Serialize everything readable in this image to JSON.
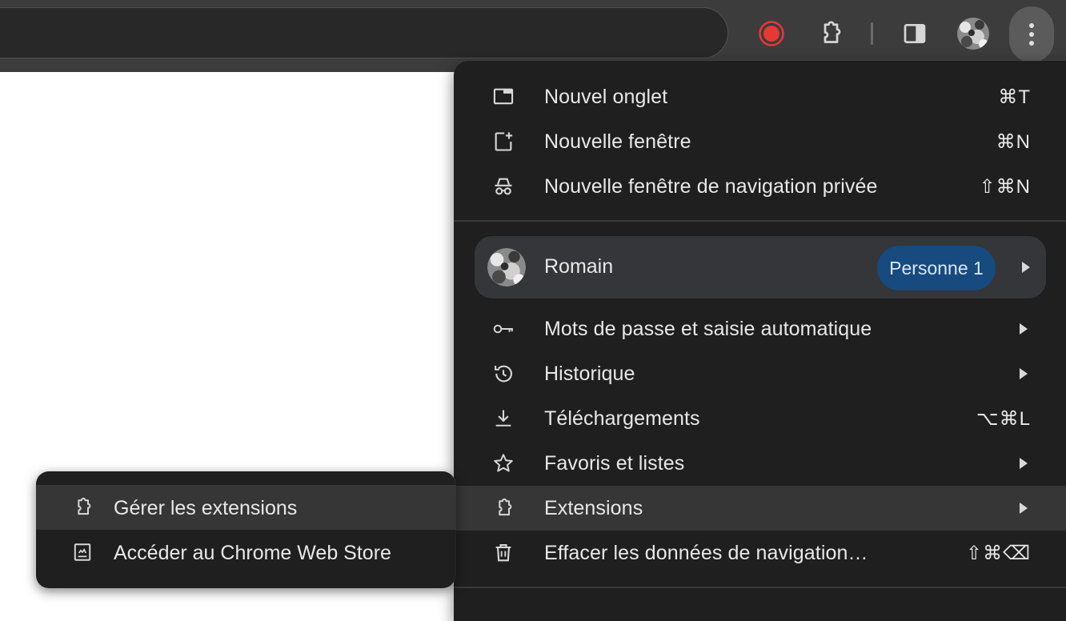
{
  "toolbar": {
    "icons": [
      "record-icon",
      "extensions-puzzle-icon",
      "side-panel-icon",
      "profile-avatar",
      "more-vert-icon"
    ],
    "record_color": "#e53935"
  },
  "menu": {
    "items_top": [
      {
        "label": "Nouvel onglet",
        "shortcut": "⌘T",
        "icon": "new-tab-icon"
      },
      {
        "label": "Nouvelle fenêtre",
        "shortcut": "⌘N",
        "icon": "new-window-icon"
      },
      {
        "label": "Nouvelle fenêtre de navigation privée",
        "shortcut": "⇧⌘N",
        "icon": "incognito-icon"
      }
    ],
    "profile": {
      "name": "Romain",
      "badge": "Personne 1"
    },
    "items_bottom": [
      {
        "label": "Mots de passe et saisie automatique",
        "icon": "key-icon",
        "submenu": true
      },
      {
        "label": "Historique",
        "icon": "history-icon",
        "submenu": true
      },
      {
        "label": "Téléchargements",
        "shortcut": "⌥⌘L",
        "icon": "download-icon"
      },
      {
        "label": "Favoris et listes",
        "icon": "star-icon",
        "submenu": true
      },
      {
        "label": "Extensions",
        "icon": "extensions-puzzle-icon",
        "submenu": true,
        "highlighted": true
      },
      {
        "label": "Effacer les données de navigation…",
        "shortcut": "⇧⌘⌫",
        "icon": "trash-icon"
      }
    ]
  },
  "submenu": {
    "items": [
      {
        "label": "Gérer les extensions",
        "icon": "extensions-puzzle-icon",
        "highlighted": true
      },
      {
        "label": "Accéder au Chrome Web Store",
        "icon": "web-store-icon"
      }
    ]
  },
  "colors": {
    "toolbar_bg": "#3c3c3c",
    "menu_bg": "#1f1f1f",
    "highlight_bg": "#363636",
    "badge_bg": "#174a7e"
  }
}
